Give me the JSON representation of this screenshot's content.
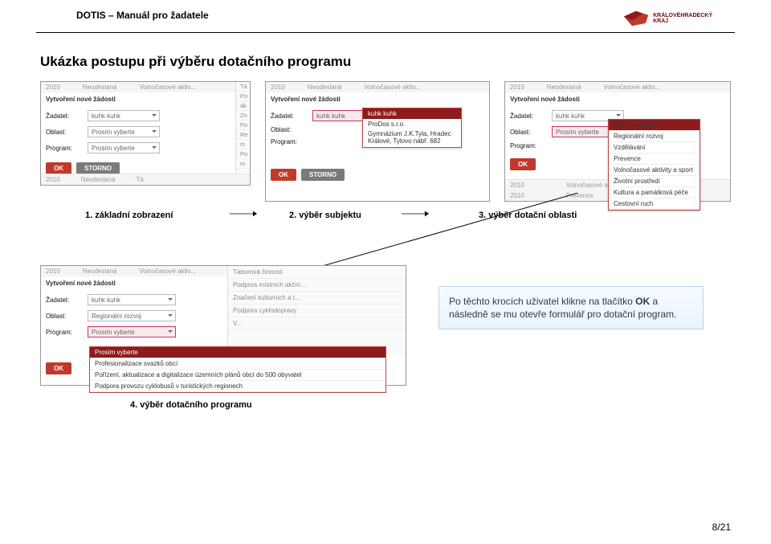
{
  "header": {
    "title": "DOTIS – Manuál pro žadatele",
    "logo_text": "KRÁLOVÉHRADECKÝ\nKRAJ"
  },
  "h2": "Ukázka postupu při výběru dotačního programu",
  "shot1": {
    "dim": [
      "2010",
      "Neodeslaná",
      "Volnočasové aktiv..."
    ],
    "title": "Vytvoření nové žádosti",
    "zadatel_lbl": "Žadatel:",
    "zadatel_val": "kuhk kuhk",
    "oblast_lbl": "Oblast:",
    "oblast_val": "Prosím vyberte",
    "program_lbl": "Program:",
    "program_val": "Prosím vyberte",
    "ok": "OK",
    "storno": "STORNO",
    "right": [
      "Tá",
      "Po",
      "ak",
      "Zn",
      "Po",
      "Re",
      "m",
      "Po",
      "m"
    ],
    "bottom": [
      "2010",
      "Neodeslaná",
      "Tá"
    ]
  },
  "shot2": {
    "dim": [
      "2010",
      "Neodeslaná",
      "Volnočasové aktiv..."
    ],
    "title": "Vytvoření nové žádosti",
    "zadatel_lbl": "Žadatel:",
    "zadatel_val": "kuhk kuhk",
    "oblast_lbl": "Oblast:",
    "program_lbl": "Program:",
    "popup": [
      "kuhk kuhk",
      "ProDos s.r.o.",
      "Gymnázium J.K.Tyla, Hradec Králové, Tylovo nábř. 682"
    ],
    "ok": "OK",
    "storno": "STORNO"
  },
  "shot3": {
    "dim": [
      "2010",
      "Neodeslaná",
      "Volnočasové aktiv..."
    ],
    "title": "Vytvoření nové žádosti",
    "zadatel_lbl": "Žadatel:",
    "zadatel_val": "kuhk kuhk",
    "oblast_lbl": "Oblast:",
    "oblast_val": "Prosím vyberte",
    "program_lbl": "Program:",
    "popup": [
      "Prosím vyberte",
      "Regionální rozvoj",
      "Vzdělávání",
      "Prevence",
      "Volnočasové aktivity a sport",
      "Životní prostředí",
      "Kultura a památková péče",
      "Cestovní ruch"
    ],
    "ok": "OK",
    "bottom1": [
      "2010",
      "",
      "Volnočasové aktiv..."
    ],
    "bottom2": [
      "2010",
      "",
      "Prevence"
    ]
  },
  "captions": {
    "c1": "1. základní zobrazení",
    "c2": "2. výběr subjektu",
    "c3": "3. výběr dotační oblasti",
    "c4": "4. výběr dotačního programu"
  },
  "shot4": {
    "dim": [
      "2010",
      "Neodeslaná",
      "Volnočasové aktiv..."
    ],
    "title": "Vytvoření nové žádosti",
    "zadatel_lbl": "Žadatel:",
    "zadatel_val": "kuhk kuhk",
    "oblast_lbl": "Oblast:",
    "oblast_val": "Regionální rozvoj",
    "program_lbl": "Program:",
    "program_val": "Prosím vyberte",
    "ok": "OK",
    "right": [
      "Táborová činnost",
      "Podpora místních akční...",
      "Značení kulturních a t...",
      "Podpora cyklodopravy",
      "V..."
    ],
    "popup": [
      "Prosím vyberte",
      "Profesionalizace svazků obcí",
      "Pořízení, aktualizace a digitalizace územních plánů obcí do 500 obyvatel",
      "Podpora provozu cyklobusů v turistických regionech"
    ]
  },
  "note": {
    "pre": "Po těchto krocích uživatel klikne na tlačítko ",
    "bold": "OK",
    "post": " a následně se mu otevře formulář pro dotační program."
  },
  "page": "8/21"
}
